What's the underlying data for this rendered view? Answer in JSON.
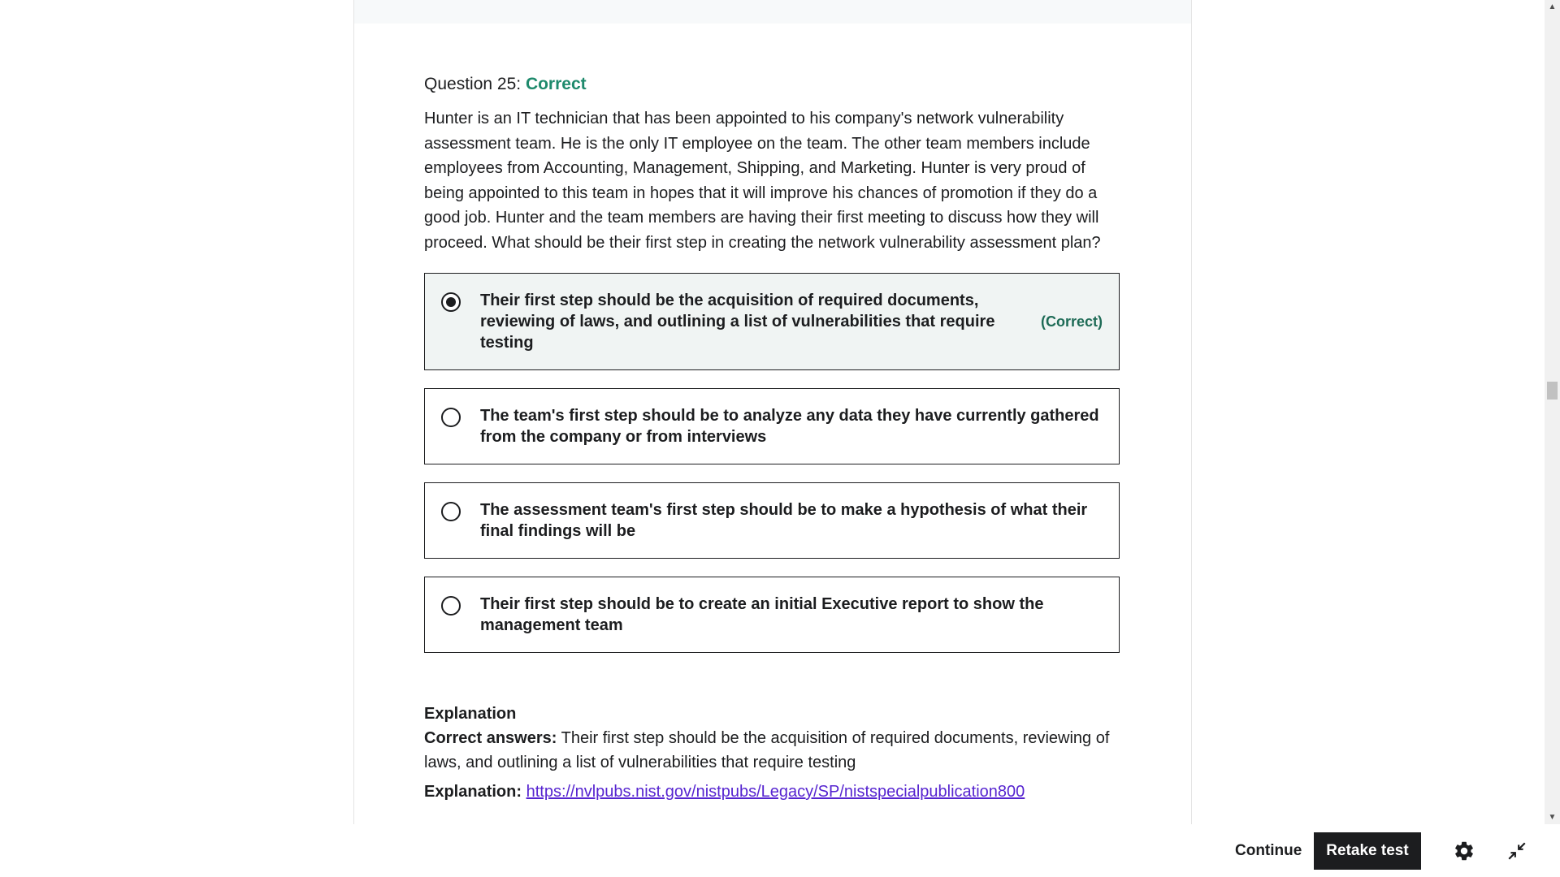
{
  "question": {
    "label": "Question 25:",
    "status": "Correct",
    "text": "Hunter is an IT technician that has been appointed to his company's network vulnerability assessment team. He is the only IT employee on the team. The other team members include employees from Accounting, Management, Shipping, and Marketing. Hunter is very proud of being appointed to this team in hopes that it will improve his chances of promotion if they do a good job. Hunter and the team members are having their first meeting to discuss how they will proceed. What should be their first step in creating the network vulnerability assessment plan?"
  },
  "options": [
    {
      "text": "Their first step should be the acquisition of required documents, reviewing of laws, and outlining a list of vulnerabilities that require testing",
      "tag": "(Correct)",
      "selected": true
    },
    {
      "text": "The team's first step should be to analyze any data they have currently gathered from the company or from interviews",
      "tag": "",
      "selected": false
    },
    {
      "text": "The assessment team's first step should be to make a hypothesis of what their final findings will be",
      "tag": "",
      "selected": false
    },
    {
      "text": "Their first step should be to create an initial Executive report to show the management team",
      "tag": "",
      "selected": false
    }
  ],
  "explanation": {
    "title": "Explanation",
    "correct_label": "Correct answers:",
    "correct_text": "Their first step should be the acquisition of required documents, reviewing of laws, and outlining a list of vulnerabilities that require testing",
    "expl_label": "Explanation:",
    "expl_link": "https://nvlpubs.nist.gov/nistpubs/Legacy/SP/nistspecialpublication800"
  },
  "footer": {
    "continue_label": "Continue",
    "retake_label": "Retake test",
    "settings_icon": "gear-icon",
    "minimize_icon": "minimize-icon"
  },
  "scrollbar": {
    "up": "▲",
    "down": "▼"
  },
  "colors": {
    "correct_green": "#1e8a6c",
    "text": "#1c1d1f",
    "link": "#5624d0",
    "selected_bg": "#f0f4f3"
  }
}
